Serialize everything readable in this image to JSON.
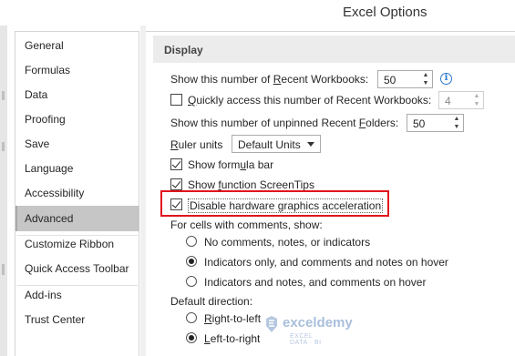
{
  "window": {
    "title": "Excel Options"
  },
  "nav": {
    "items": [
      {
        "label": "General"
      },
      {
        "label": "Formulas"
      },
      {
        "label": "Data"
      },
      {
        "label": "Proofing"
      },
      {
        "label": "Save"
      },
      {
        "label": "Language"
      },
      {
        "label": "Accessibility"
      },
      {
        "label": "Advanced",
        "active": true
      },
      {
        "label": "Customize Ribbon"
      },
      {
        "label": "Quick Access Toolbar"
      },
      {
        "label": "Add-ins"
      },
      {
        "label": "Trust Center"
      }
    ]
  },
  "display": {
    "header": "Display",
    "recent_workbooks": {
      "pre": "Show this number of ",
      "key": "R",
      "post": "ecent Workbooks:",
      "value": "50"
    },
    "quick_access": {
      "checked": false,
      "key": "Q",
      "post": "uickly access this number of Recent Workbooks:",
      "value": "4"
    },
    "unpinned_folders": {
      "pre": "Show this number of unpinned Recent ",
      "key": "F",
      "post": "olders:",
      "value": "50"
    },
    "ruler_units": {
      "key": "R",
      "post": "uler units",
      "value": "Default Units"
    },
    "formula_bar": {
      "checked": true,
      "pre": "Show form",
      "key": "u",
      "post": "la bar"
    },
    "screentips": {
      "checked": true,
      "pre": "Show ",
      "key": "f",
      "post": "unction ScreenTips"
    },
    "hw_accel": {
      "checked": true,
      "pre": "Disable hardware ",
      "key": "g",
      "post": "raphics acceleration"
    },
    "comments": {
      "label": "For cells with comments, show:",
      "options": [
        {
          "label": "No comments, notes, or indicators",
          "selected": false
        },
        {
          "label": "Indicators only, and comments and notes on hover",
          "selected": true
        },
        {
          "label": "Indicators and notes, and comments on hover",
          "selected": false
        }
      ]
    },
    "direction": {
      "label": "Default direction:",
      "options": [
        {
          "pre": "",
          "key": "R",
          "post": "ight-to-left",
          "selected": false
        },
        {
          "pre": "",
          "key": "L",
          "post": "eft-to-right",
          "selected": true
        }
      ]
    }
  },
  "watermark": {
    "name": "exceldemy",
    "tagline": "EXCEL · DATA · BI"
  },
  "colors": {
    "highlight": "#e0141e",
    "info": "#2b78d0",
    "selected_nav": "#c6c6c6"
  }
}
